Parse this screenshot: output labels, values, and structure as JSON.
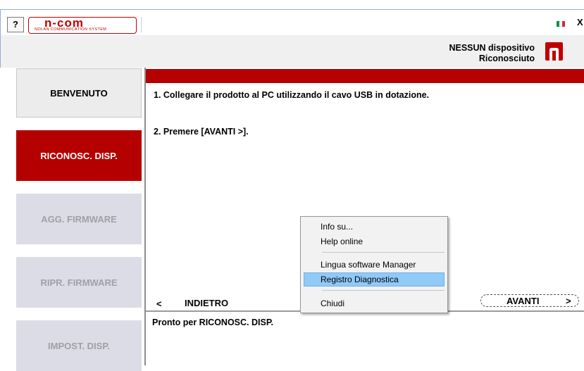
{
  "header": {
    "help_label": "?",
    "logo_text": "n-com",
    "logo_subtitle": "NOLAN COMMUNICATION SYSTEM",
    "close_label": "X",
    "device_status_line1": "NESSUN dispositivo",
    "device_status_line2": "Riconosciuto",
    "flag_colors": [
      "#009246",
      "#ffffff",
      "#ce2b37"
    ]
  },
  "sidebar": {
    "steps": [
      {
        "label": "BENVENUTO",
        "state": "done"
      },
      {
        "label": "RICONOSC. DISP.",
        "state": "active"
      },
      {
        "label": "AGG. FIRMWARE",
        "state": "disabled"
      },
      {
        "label": "RIPR. FIRMWARE",
        "state": "disabled"
      },
      {
        "label": "IMPOST. DISP.",
        "state": "disabled"
      }
    ]
  },
  "main": {
    "instruction_1": "1. Collegare il prodotto al PC utilizzando il cavo USB in dotazione.",
    "instruction_2": "2. Premere [AVANTI >].",
    "back_arrow": "<",
    "back_label": "INDIETRO",
    "next_label": "AVANTI",
    "next_arrow": ">",
    "status": "Pronto per RICONOSC. DISP."
  },
  "context_menu": {
    "items": [
      {
        "label": "Info su..."
      },
      {
        "label": "Help online"
      },
      {
        "label": "Lingua software Manager"
      },
      {
        "label": "Registro Diagnostica",
        "highlighted": true
      },
      {
        "label": "Chiudi"
      }
    ]
  },
  "colors": {
    "accent_red": "#b50000",
    "menu_highlight": "#91c9f7"
  }
}
